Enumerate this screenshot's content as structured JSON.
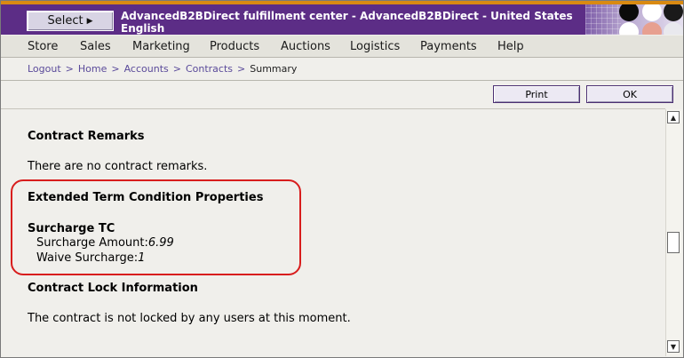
{
  "header": {
    "select_label": "Select",
    "select_arrow_icon": "triangle-right-icon",
    "title_line1": "AdvancedB2BDirect fulfillment center - AdvancedB2BDirect - United States",
    "title_line2": "English",
    "accent_color": "#5c2d86",
    "top_strip_color": "#d98a12"
  },
  "menu": {
    "items": [
      "Store",
      "Sales",
      "Marketing",
      "Products",
      "Auctions",
      "Logistics",
      "Payments",
      "Help"
    ]
  },
  "breadcrumb": {
    "items": [
      "Logout",
      "Home",
      "Accounts",
      "Contracts"
    ],
    "separator": ">",
    "current": "Summary"
  },
  "toolbar": {
    "print_label": "Print",
    "ok_label": "OK"
  },
  "content": {
    "remarks_heading": "Contract Remarks",
    "remarks_text": "There are no contract remarks.",
    "ext_heading": "Extended Term Condition Properties",
    "surcharge_heading": "Surcharge TC",
    "surcharge_amount_label": "Surcharge Amount:",
    "surcharge_amount_value": "6.99",
    "waive_label": "Waive Surcharge:",
    "waive_value": "1",
    "lock_heading": "Contract Lock Information",
    "lock_text": "The contract is not locked by any users at this moment."
  }
}
